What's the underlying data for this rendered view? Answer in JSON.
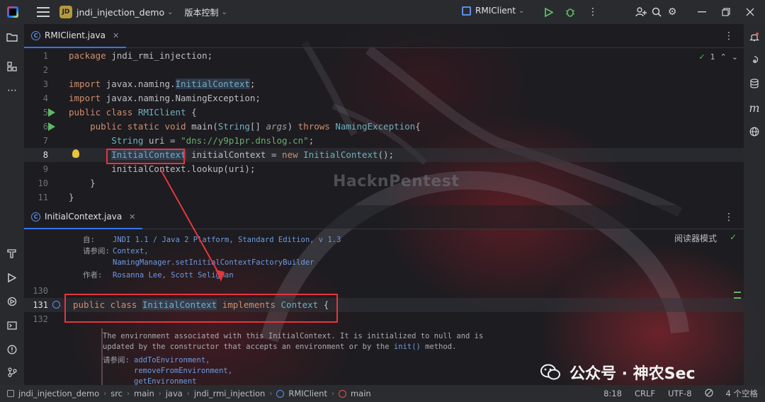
{
  "titlebar": {
    "project_badge": "JD",
    "project_name": "jndi_injection_demo",
    "vcs": "版本控制",
    "run_config": "RMIClient"
  },
  "editor_top": {
    "tab_label": "RMIClient.java",
    "inspection_count": "1",
    "lines": [
      {
        "no": "1"
      },
      {
        "no": "2"
      },
      {
        "no": "3"
      },
      {
        "no": "4"
      },
      {
        "no": "5"
      },
      {
        "no": "6"
      },
      {
        "no": "7"
      },
      {
        "no": "8"
      },
      {
        "no": "9"
      },
      {
        "no": "10"
      },
      {
        "no": "11"
      }
    ],
    "code": {
      "l1_kw": "package",
      "l1_rest": " jndi_rmi_injection;",
      "l3_kw": "import",
      "l3_pkg": " javax.naming.",
      "l3_cls": "InitialContext",
      "l3_end": ";",
      "l4_kw": "import",
      "l4_pkg": " javax.naming.NamingException;",
      "l5_kw": "public class",
      "l5_cls": " RMIClient",
      "l5_end": " {",
      "l6_kw": "public static void",
      "l6_m": " main(",
      "l6_t": "String",
      "l6_b": "[] ",
      "l6_p": "args",
      "l6_c": ") ",
      "l6_kw2": "throws",
      "l6_cls": " NamingException",
      "l6_end": "{",
      "l7_t": "String",
      "l7_a": " uri = ",
      "l7_s": "\"dns://y9p1pr.dnslog.cn\"",
      "l7_e": ";",
      "l8_cls": "InitialContext",
      "l8_a": " initialContext = ",
      "l8_kw": "new",
      "l8_cls2": " InitialContext",
      "l8_e": "();",
      "l9": "initialContext.lookup(uri);",
      "l10": "}",
      "l11": "}"
    }
  },
  "editor_bottom": {
    "tab_label": "InitialContext.java",
    "reader_mode": "阅读器模式",
    "doc_since_label": "自:",
    "doc_since_value": "JNDI 1.1 / Java 2 Platform, Standard Edition, v 1.3",
    "doc_see_label": "请参阅:",
    "doc_see_1": "Context,",
    "doc_see_2": "NamingManager.setInitialContextFactoryBuilder",
    "doc_author_label": "作者:",
    "doc_author_value": "Rosanna Lee, Scott Seligman",
    "ln_130": "130",
    "ln_131": "131",
    "ln_132": "132",
    "class_kw": "public class ",
    "class_name": "InitialContext",
    "class_impl": " implements ",
    "class_iface": "Context",
    "class_brace": " {",
    "env_doc_1": "The environment associated with this InitialContext. It is initialized to null and is",
    "env_doc_2a": "updated by the constructor that accepts an environment or by the ",
    "env_doc_2b": "init()",
    "env_doc_2c": " method.",
    "env_see_label": "请参阅:",
    "env_see_1": "addToEnvironment,",
    "env_see_2": "removeFromEnvironment,",
    "env_see_3": "getEnvironment"
  },
  "watermarks": {
    "logo": "HacknPentest",
    "wechat": "公众号 · 神农Sec"
  },
  "statusbar": {
    "crumbs": [
      "jndi_injection_demo",
      "src",
      "main",
      "java",
      "jndi_rmi_injection",
      "RMIClient",
      "main"
    ],
    "position": "8:18",
    "line_sep": "CRLF",
    "encoding": "UTF-8",
    "indent": "4 个空格"
  }
}
